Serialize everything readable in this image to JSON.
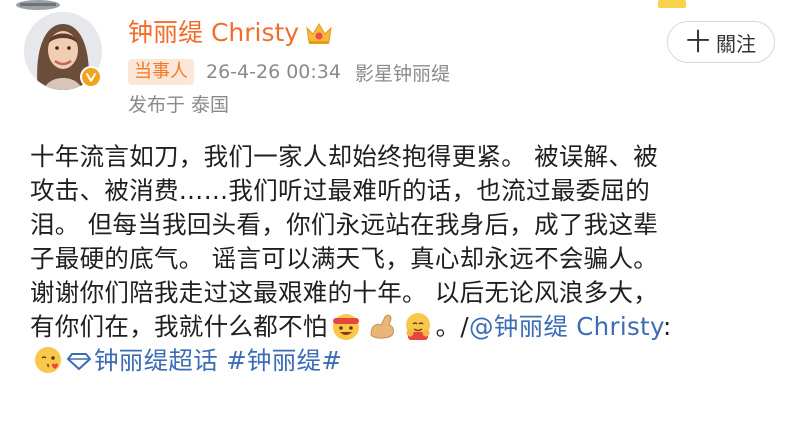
{
  "user": {
    "name": "钟丽缇 Christy",
    "badge": "当事人",
    "time": "26-4-26 00:34",
    "title": "影星钟丽缇",
    "location": "发布于 泰国",
    "brand_color": "#f26c2a"
  },
  "follow_button": {
    "plus": "十",
    "label": "關注"
  },
  "post": {
    "line1": "十年流言如刀，我们一家人却始终抱得更紧。 被误解、被",
    "line2": "攻击、被消费……我们听过最难听的话，也流过最委屈的",
    "line3": "泪。 但每当我回头看，你们永远站在我身后，成了我这辈",
    "line4": "子最硬的底气。 谣言可以满天飞，真心却永远不会骗人。",
    "line5": "谢谢你们陪我走过这最艰难的十年。 以后无论风浪多大，",
    "line6_text": "有你们在，我就什么都不怕",
    "line6_after_emojis": "。/",
    "mention": "@钟丽缇 Christy",
    "mention_suffix": ":",
    "topic1": "钟丽缇超话",
    "topic2": "#钟丽缇#"
  },
  "icons": {
    "emoji1": "grinning-face-with-headband-icon",
    "emoji2": "flexed-biceps-icon",
    "emoji3": "hugging-face-icon",
    "emoji4": "face-blowing-kiss-icon",
    "topic": "diamond-topic-icon",
    "crown": "crown-icon",
    "verified": "verified-icon"
  },
  "link_color": "#3b6cb5"
}
